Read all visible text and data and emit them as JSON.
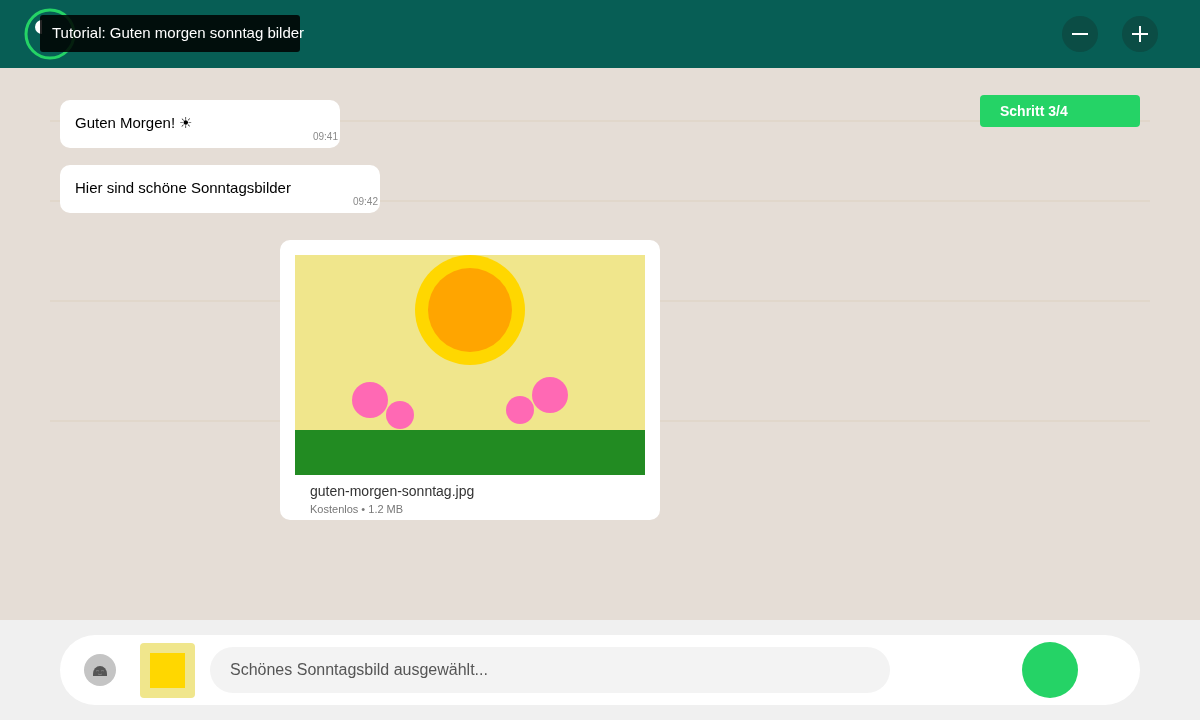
{
  "header": {
    "tooltip": "Tutorial: Guten morgen sonntag bilder",
    "buttons": [
      {
        "kind": "minus"
      },
      {
        "kind": "plus"
      }
    ]
  },
  "step_badge": "Schritt 3/4",
  "messages": [
    {
      "kind": "text",
      "text": "Guten Morgen! ☀",
      "time": "09:41"
    },
    {
      "kind": "text",
      "text": "Hier sind schöne Sonntagsbilder",
      "time": "09:42"
    },
    {
      "filename": "guten-morgen-sonntag.jpg",
      "details": "Kostenlos • 1.2 MB"
    }
  ],
  "composer": {
    "placeholder": "Schönes Sonntagsbild ausgewählt..."
  }
}
